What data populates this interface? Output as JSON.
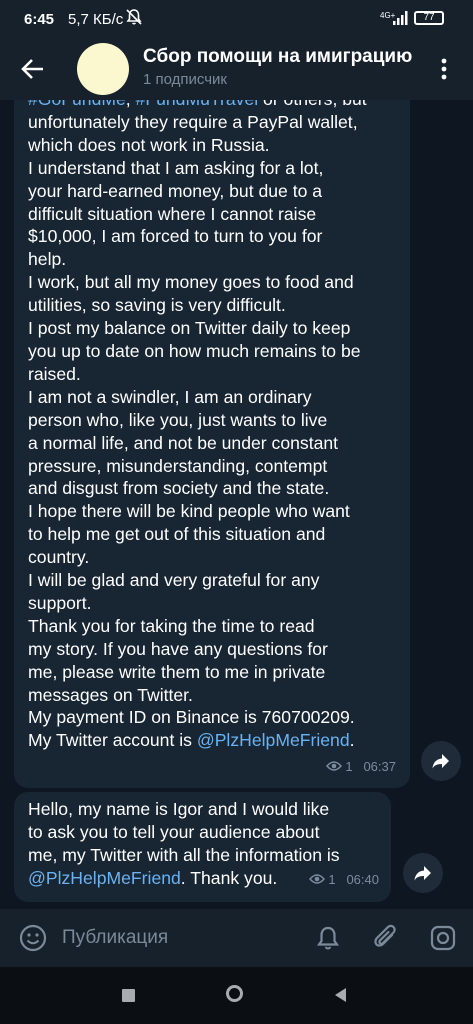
{
  "status_bar": {
    "time": "6:45",
    "net_speed": "5,7 КБ/с",
    "network_label": "4G+",
    "battery": "77"
  },
  "header": {
    "channel_title": "Сбор помощи на имиграцию",
    "subtitle": "1 подписчик"
  },
  "messages": [
    {
      "lines": [
        [
          {
            "t": "#GoFundMe",
            "tag": true
          },
          {
            "t": ", "
          },
          {
            "t": "#FundMuTravel",
            "tag": true
          },
          {
            "t": " or others, but"
          }
        ],
        [
          {
            "t": "unfortunately they require a PayPal wallet,"
          }
        ],
        [
          {
            "t": "which does not work in Russia."
          }
        ],
        [
          {
            "t": "I understand that I am asking for a lot,"
          }
        ],
        [
          {
            "t": "your hard-earned money, but due to a"
          }
        ],
        [
          {
            "t": "difficult situation where I cannot raise"
          }
        ],
        [
          {
            "t": "$10,000, I am forced to turn to you for"
          }
        ],
        [
          {
            "t": "help."
          }
        ],
        [
          {
            "t": "I work, but all my money goes to food and"
          }
        ],
        [
          {
            "t": "utilities, so saving is very difficult."
          }
        ],
        [
          {
            "t": "I post my balance on Twitter daily to keep"
          }
        ],
        [
          {
            "t": "you up to date on how much remains to be"
          }
        ],
        [
          {
            "t": "raised."
          }
        ],
        [
          {
            "t": "I am not a swindler, I am an ordinary"
          }
        ],
        [
          {
            "t": "person who, like you, just wants to live"
          }
        ],
        [
          {
            "t": "a normal life, and not be under constant"
          }
        ],
        [
          {
            "t": "pressure, misunderstanding, contempt"
          }
        ],
        [
          {
            "t": "and disgust from society and the state."
          }
        ],
        [
          {
            "t": "I hope there will be kind people who want"
          }
        ],
        [
          {
            "t": "to help me get out of this situation and"
          }
        ],
        [
          {
            "t": "country."
          }
        ],
        [
          {
            "t": "I will be glad and very grateful for any"
          }
        ],
        [
          {
            "t": "support."
          }
        ],
        [
          {
            "t": "Thank you for taking the time to read"
          }
        ],
        [
          {
            "t": "my story. If you have any questions for"
          }
        ],
        [
          {
            "t": "me, please write them to me in private"
          }
        ],
        [
          {
            "t": "messages on Twitter."
          }
        ],
        [
          {
            "t": "My payment ID on Binance is 760700209."
          }
        ],
        [
          {
            "t": "My Twitter account is "
          },
          {
            "t": "@PlzHelpMeFriend",
            "tag": true
          },
          {
            "t": "."
          }
        ]
      ],
      "views": "1",
      "time": "06:37"
    },
    {
      "lines": [
        [
          {
            "t": "Hello, my name is Igor and I would like"
          }
        ],
        [
          {
            "t": "to ask you to tell your audience about"
          }
        ],
        [
          {
            "t": "me, my Twitter with all the information is"
          }
        ],
        [
          {
            "t": "@PlzHelpMeFriend",
            "tag": true
          },
          {
            "t": ". Thank you."
          }
        ]
      ],
      "views": "1",
      "time": "06:40"
    }
  ],
  "input_bar": {
    "placeholder": "Публикация"
  },
  "colors": {
    "background": "#0e1621",
    "header": "#17212b",
    "bubble": "#182533",
    "link": "#6ab2f2",
    "meta": "#7b8c9e"
  },
  "icons": [
    "back-arrow-icon",
    "more-vert-icon",
    "eye-icon",
    "share-icon",
    "emoji-icon",
    "bell-icon",
    "paperclip-icon",
    "camera-icon",
    "mute-icon",
    "signal-icon",
    "battery-icon"
  ]
}
